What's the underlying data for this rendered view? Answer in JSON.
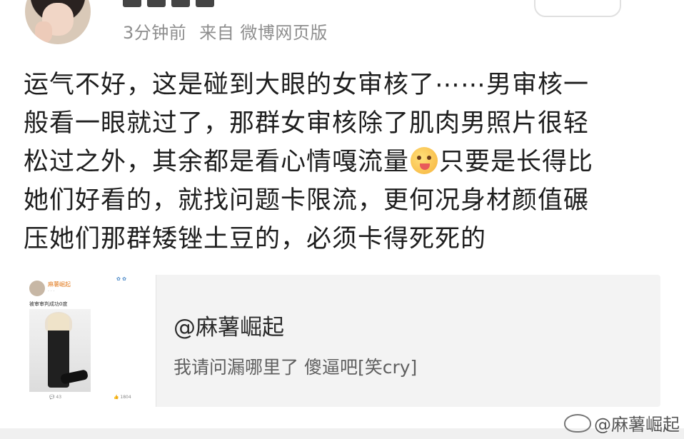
{
  "post": {
    "meta_time": "3分钟前",
    "meta_source": "来自 微博网页版",
    "body_lines": [
      "运气不好，这是碰到大眼的女审核了⋯⋯男审核一",
      "般看一眼就过了，那群女审核除了肌肉男照片很轻",
      "松过之外，其余都是看心情嘎流量",
      "只要是长得比",
      "她们好看的，就找问题卡限流，更何况身材颜值碾",
      "压她们那群矮锉土豆的，必须卡得死死的"
    ],
    "emoji_icon": "drooling-face-emoji"
  },
  "repost": {
    "title": "@麻薯崛起",
    "body": "我请问漏哪里了 傻逼吧[笑cry]",
    "thumbnail": {
      "name": "麻薯崛起",
      "caption": "被审审判成功0度",
      "comments": "43",
      "likes": "1804"
    }
  },
  "watermark": "@麻薯崛起"
}
